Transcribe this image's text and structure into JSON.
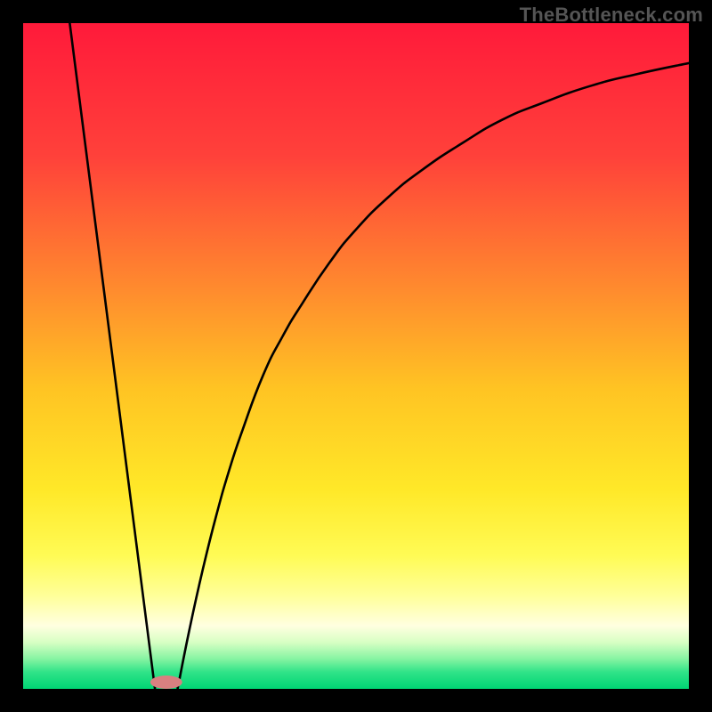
{
  "watermark": "TheBottleneck.com",
  "chart_data": {
    "type": "line",
    "title": "",
    "xlabel": "",
    "ylabel": "",
    "xlim": [
      0,
      100
    ],
    "ylim": [
      0,
      100
    ],
    "grid": false,
    "legend": false,
    "background_gradient": {
      "stops": [
        {
          "offset": 0.0,
          "color": "#ff1a3a"
        },
        {
          "offset": 0.2,
          "color": "#ff413a"
        },
        {
          "offset": 0.4,
          "color": "#ff8b2e"
        },
        {
          "offset": 0.55,
          "color": "#ffc423"
        },
        {
          "offset": 0.7,
          "color": "#ffe828"
        },
        {
          "offset": 0.8,
          "color": "#fffb55"
        },
        {
          "offset": 0.86,
          "color": "#ffff99"
        },
        {
          "offset": 0.905,
          "color": "#ffffe0"
        },
        {
          "offset": 0.93,
          "color": "#d8ffc4"
        },
        {
          "offset": 0.955,
          "color": "#86f4a2"
        },
        {
          "offset": 0.975,
          "color": "#2fe388"
        },
        {
          "offset": 1.0,
          "color": "#00d574"
        }
      ]
    },
    "valley_marker": {
      "x": 21.5,
      "y": 1.0,
      "color": "#d88080",
      "rx": 2.4,
      "ry": 1.0
    },
    "series": [
      {
        "name": "left-segment",
        "style": "line",
        "x": [
          7.0,
          19.8
        ],
        "y": [
          100.0,
          0.0
        ]
      },
      {
        "name": "right-segment",
        "style": "curve",
        "x": [
          23.2,
          25,
          27,
          29,
          31,
          33,
          36,
          39,
          42,
          46,
          50,
          55,
          60,
          66,
          72,
          78,
          85,
          92,
          100
        ],
        "y": [
          0.0,
          9,
          18,
          26,
          33,
          39,
          47,
          53,
          58,
          64,
          69,
          74,
          78,
          82,
          85.5,
          88,
          90.5,
          92.3,
          94
        ]
      }
    ]
  }
}
